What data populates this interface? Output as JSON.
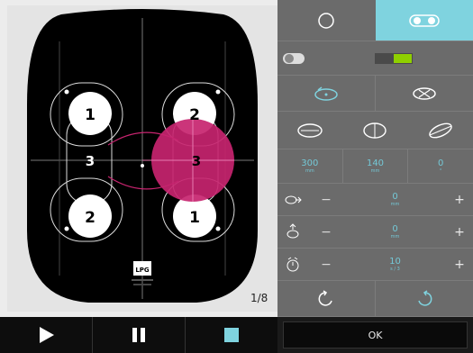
{
  "stage": {
    "page_counter": "1/8",
    "logo_text": "LPG",
    "zones": [
      {
        "label": "1"
      },
      {
        "label": "2"
      },
      {
        "label": "3"
      },
      {
        "label": "2"
      },
      {
        "label": "3"
      },
      {
        "label": "1"
      }
    ]
  },
  "transport": {
    "play_icon": "play-icon",
    "pause_icon": "pause-icon",
    "stop_icon": "stop-icon"
  },
  "right_panel": {
    "values": [
      {
        "value": "300",
        "unit": "mm"
      },
      {
        "value": "140",
        "unit": "mm"
      },
      {
        "value": "0",
        "unit": "°"
      }
    ],
    "steppers": [
      {
        "minus": "−",
        "value": "0",
        "unit": "mm",
        "plus": "+"
      },
      {
        "minus": "−",
        "value": "0",
        "unit": "mm",
        "plus": "+"
      },
      {
        "minus": "−",
        "value": "10",
        "unit": "s / 3",
        "plus": "+"
      }
    ],
    "ok_label": "OK",
    "colors": {
      "accent": "#7fd3df",
      "toggle_on": "#8fd000",
      "magenta": "#c7246f"
    }
  }
}
